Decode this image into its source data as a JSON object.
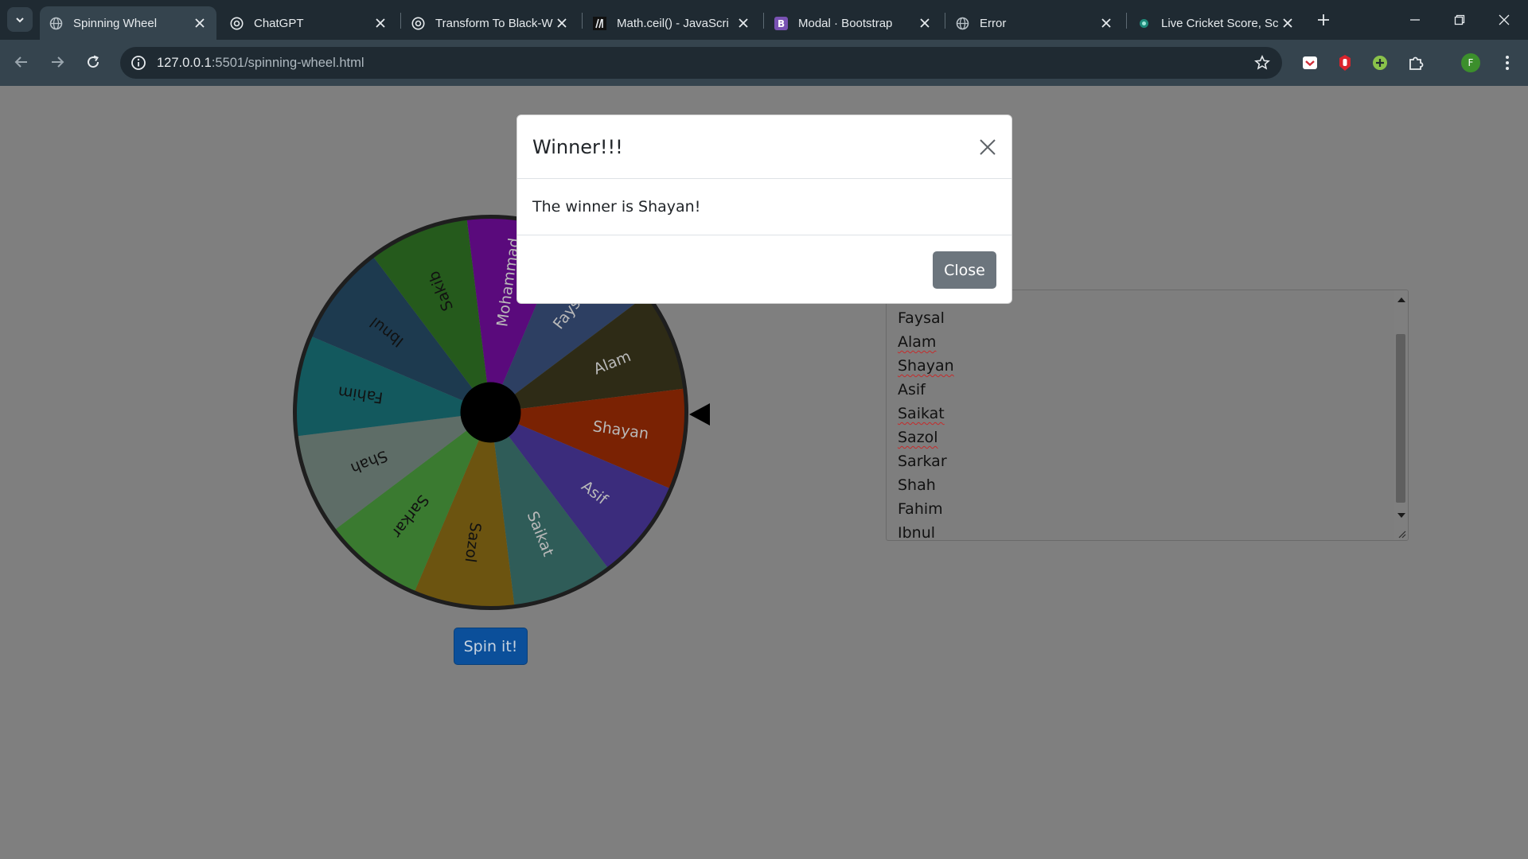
{
  "browser": {
    "tabs": [
      {
        "title": "Spinning Wheel",
        "icon": "globe-icon",
        "active": true
      },
      {
        "title": "ChatGPT",
        "icon": "chatgpt-icon",
        "active": false
      },
      {
        "title": "Transform To Black-W",
        "icon": "chatgpt-icon",
        "active": false
      },
      {
        "title": "Math.ceil() - JavaScri",
        "icon": "mdn-icon",
        "active": false
      },
      {
        "title": "Modal · Bootstrap",
        "icon": "bootstrap-icon",
        "active": false
      },
      {
        "title": "Error",
        "icon": "globe-icon",
        "active": false
      },
      {
        "title": "Live Cricket Score, Sc",
        "icon": "cricket-icon",
        "active": false
      }
    ],
    "url": "127.0.0.1:5501/spinning-wheel.html",
    "url_host": "127.0.0.1",
    "url_rest": ":5501/spinning-wheel.html",
    "profile_initial": "F",
    "colors": {
      "tabstrip": "#1f2a32",
      "toolbar": "#35444e",
      "profile": "#3c8f2c"
    }
  },
  "wheel": {
    "segments": [
      {
        "label": "Mohammad",
        "color": "#5a0a7c"
      },
      {
        "label": "Faysal",
        "color": "#2d3f62"
      },
      {
        "label": "Alam",
        "color": "#2e2b16"
      },
      {
        "label": "Shayan",
        "color": "#7a2203"
      },
      {
        "label": "Asif",
        "color": "#3b2c7c"
      },
      {
        "label": "Saikat",
        "color": "#2f5c58"
      },
      {
        "label": "Sazol",
        "color": "#6c5410"
      },
      {
        "label": "Sarkar",
        "color": "#3a7a30"
      },
      {
        "label": "Shah",
        "color": "#5e6d67"
      },
      {
        "label": "Fahim",
        "color": "#13595e"
      },
      {
        "label": "Ibnul",
        "color": "#1d3a4f"
      },
      {
        "label": "Sakib",
        "color": "#255a1c"
      }
    ],
    "spin_label": "Spin it!"
  },
  "names": [
    "Faysal",
    "Alam",
    "Shayan",
    "Asif",
    "Saikat",
    "Sazol",
    "Sarkar",
    "Shah",
    "Fahim",
    "Ibnul"
  ],
  "modal": {
    "title": "Winner!!!",
    "message": "The winner is Shayan!",
    "close_label": "Close"
  }
}
